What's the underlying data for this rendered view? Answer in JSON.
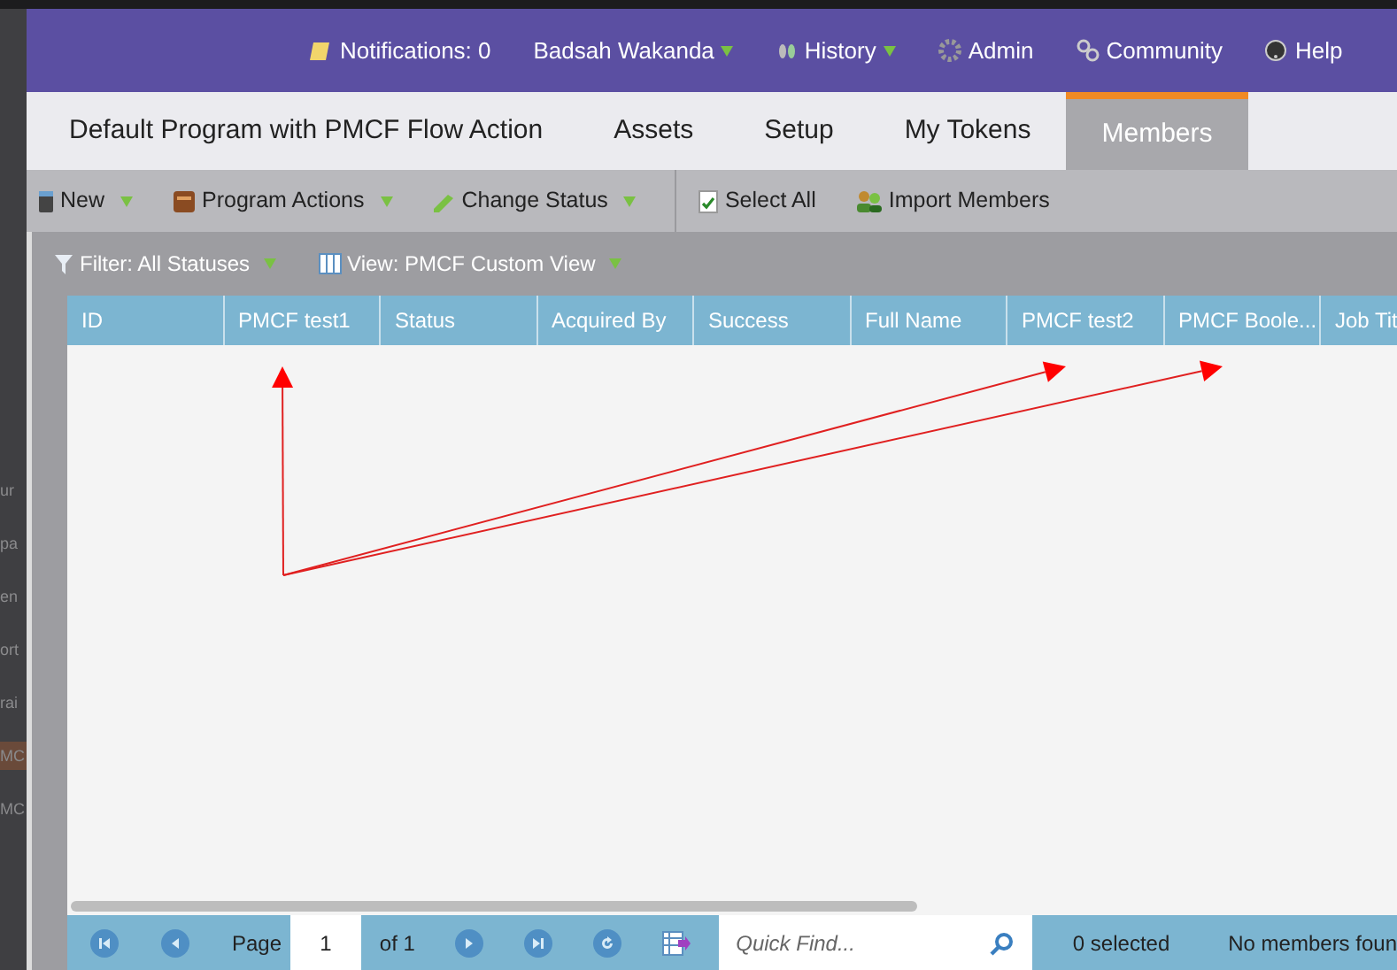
{
  "background_menu": [
    "ur",
    "pa",
    "en",
    "ort",
    "rai",
    "MC",
    "MC"
  ],
  "header": {
    "notifications": "Notifications: 0",
    "user": "Badsah Wakanda",
    "history": "History",
    "admin": "Admin",
    "community": "Community",
    "help": "Help"
  },
  "tabs": [
    {
      "label": "Default Program with PMCF Flow Action",
      "selected": false
    },
    {
      "label": "Assets",
      "selected": false
    },
    {
      "label": "Setup",
      "selected": false
    },
    {
      "label": "My Tokens",
      "selected": false
    },
    {
      "label": "Members",
      "selected": true
    }
  ],
  "toolbar": [
    {
      "label": "New",
      "kind": "new",
      "dropdown": true
    },
    {
      "label": "Program Actions",
      "kind": "actions",
      "dropdown": true
    },
    {
      "label": "Change Status",
      "kind": "status",
      "dropdown": true
    },
    {
      "label": "Select All",
      "kind": "select",
      "dropdown": false
    },
    {
      "label": "Import Members",
      "kind": "import",
      "dropdown": false
    }
  ],
  "filter": {
    "label": "Filter: All Statuses",
    "view": "View: PMCF Custom View"
  },
  "table": {
    "columns": [
      "ID",
      "PMCF test1",
      "Status",
      "Acquired By",
      "Success",
      "Full Name",
      "PMCF test2",
      "PMCF Boole...",
      "Job Tit"
    ]
  },
  "pager": {
    "page_label": "Page",
    "page": "1",
    "of": "of 1",
    "search": {
      "placeholder": "Quick Find..."
    },
    "selected": "0 selected",
    "status": "No members foun"
  }
}
